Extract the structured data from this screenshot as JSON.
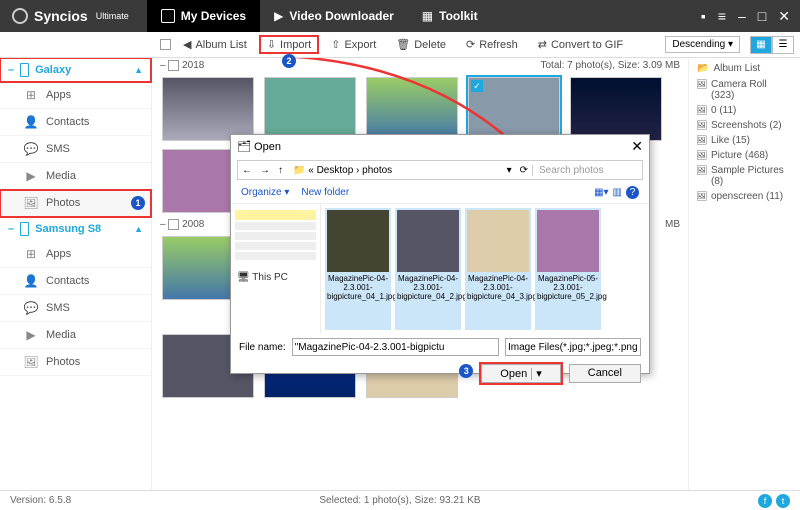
{
  "brand": {
    "name": "Syncios",
    "edition": "Ultimate"
  },
  "topnav": [
    {
      "label": "My Devices",
      "active": true
    },
    {
      "label": "Video Downloader"
    },
    {
      "label": "Toolkit"
    }
  ],
  "toolbar": {
    "album_list": "Album List",
    "import": "Import",
    "export": "Export",
    "delete": "Delete",
    "refresh": "Refresh",
    "convert": "Convert to GIF",
    "sort": "Descending ▾"
  },
  "sidebar": {
    "devices": [
      {
        "name": "Galaxy",
        "items": [
          "Apps",
          "Contacts",
          "SMS",
          "Media",
          "Photos"
        ]
      },
      {
        "name": "Samsung S8",
        "items": [
          "Apps",
          "Contacts",
          "SMS",
          "Media",
          "Photos"
        ]
      }
    ],
    "selected": "Photos"
  },
  "album_panel": {
    "title": "Album List",
    "items": [
      "Camera Roll (323)",
      "0 (11)",
      "Screenshots (2)",
      "Like (15)",
      "Picture (468)",
      "Sample Pictures (8)",
      "openscreen (11)"
    ]
  },
  "content": {
    "groups": [
      {
        "year": "2018",
        "stats": "Total: 7 photo(s), Size: 3.09 MB"
      },
      {
        "year": "2008",
        "stats": "MB"
      }
    ]
  },
  "dialog": {
    "title": "Open",
    "crumb_icon": "📁",
    "crumb": "« Desktop › photos",
    "search_placeholder": "Search photos",
    "organize": "Organize ▾",
    "newfolder": "New folder",
    "thispc": "This PC",
    "files": [
      "MagazinePic-04-2.3.001-bigpicture_04_1.jpg",
      "MagazinePic-04-2.3.001-bigpicture_04_2.jpg",
      "MagazinePic-04-2.3.001-bigpicture_04_3.jpg",
      "MagazinePic-05-2.3.001-bigpicture_05_2.jpg"
    ],
    "filename_label": "File name:",
    "filename_value": "\"MagazinePic-04-2.3.001-bigpictu",
    "filter": "Image Files(*.jpg;*.jpeg;*.png;*.",
    "open": "Open",
    "cancel": "Cancel"
  },
  "status": {
    "version": "Version: 6.5.8",
    "selection": "Selected: 1 photo(s), Size: 93.21 KB"
  },
  "badges": {
    "photos": "1",
    "import": "2",
    "open": "3"
  }
}
